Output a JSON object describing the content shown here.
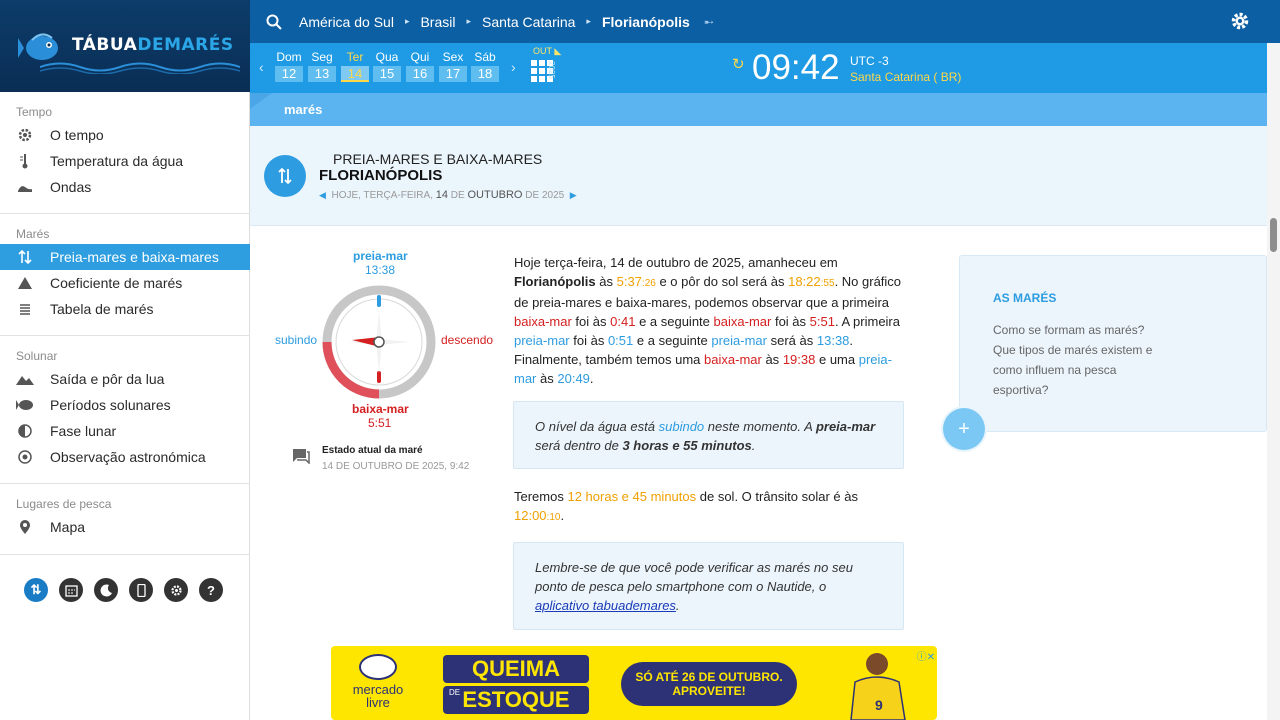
{
  "brand": {
    "logo_prefix": "TÁBUA",
    "logo_highlight": "DEMARÉS"
  },
  "breadcrumb": [
    {
      "label": "América do Sul"
    },
    {
      "label": "Brasil"
    },
    {
      "label": "Santa Catarina"
    },
    {
      "label": "Florianópolis"
    }
  ],
  "sidebar": {
    "sections": [
      {
        "heading": "Tempo",
        "items": [
          {
            "label": "O tempo",
            "icon": "gear-icon"
          },
          {
            "label": "Temperatura da água",
            "icon": "thermometer-icon"
          },
          {
            "label": "Ondas",
            "icon": "waves-icon"
          }
        ]
      },
      {
        "heading": "Marés",
        "items": [
          {
            "label": "Preia-mares e baixa-mares",
            "icon": "up-down-arrows-icon",
            "active": true
          },
          {
            "label": "Coeficiente de marés",
            "icon": "triangle-icon"
          },
          {
            "label": "Tabela de marés",
            "icon": "table-icon"
          }
        ]
      },
      {
        "heading": "Solunar",
        "items": [
          {
            "label": "Saída e pôr da lua",
            "icon": "mountains-icon"
          },
          {
            "label": "Períodos solunares",
            "icon": "fish-icon"
          },
          {
            "label": "Fase lunar",
            "icon": "half-moon-icon"
          },
          {
            "label": "Observação astronómica",
            "icon": "target-icon"
          }
        ]
      },
      {
        "heading": "Lugares de pesca",
        "items": [
          {
            "label": "Mapa",
            "icon": "map-pin-icon"
          }
        ]
      }
    ],
    "tools": [
      "tides-icon",
      "calendar-icon",
      "moon-icon",
      "phone-icon",
      "settings-icon",
      "help-icon"
    ]
  },
  "daybar": {
    "days": [
      {
        "name": "Dom",
        "date": "12"
      },
      {
        "name": "Seg",
        "date": "13"
      },
      {
        "name": "Ter",
        "date": "14",
        "active": true
      },
      {
        "name": "Qua",
        "date": "15"
      },
      {
        "name": "Qui",
        "date": "16"
      },
      {
        "name": "Sex",
        "date": "17"
      },
      {
        "name": "Sáb",
        "date": "18"
      }
    ],
    "month": "OUT",
    "year": "2025",
    "time": "09:42",
    "utc": "UTC -3",
    "region": "Santa Catarina ( BR)"
  },
  "section_strip": {
    "label": "marés"
  },
  "title_band": {
    "pretitle": "PREIA-MARES E BAIXA-MARES",
    "place": "FLORIANÓPOLIS",
    "date_prefix": "HOJE, TERÇA-FEIRA,",
    "date_day": "14",
    "date_de1": "DE",
    "date_month": "OUTUBRO",
    "date_de2": "DE",
    "date_year": "2025"
  },
  "dial": {
    "high_label": "preia-mar",
    "high_time": "13:38",
    "low_label": "baixa-mar",
    "low_time": "5:51",
    "left_label": "subindo",
    "right_label": "descendo",
    "colors": {
      "high": "#2d9ce0",
      "low": "#d42020"
    }
  },
  "estado": {
    "title": "Estado atual da maré",
    "timestamp": "14 DE OUTUBRO DE 2025, 9:42"
  },
  "description": {
    "p1": "Hoje terça-feira, 14 de outubro de 2025, amanheceu em",
    "place": "Florianópolis",
    "p2": "às",
    "sunrise": "5:37",
    "sunrise_sec": ":26",
    "p3": "e o pôr do sol será às",
    "sunset": "18:22",
    "sunset_sec": ":55",
    "p4": ". No gráfico de preia-mares e baixa-mares, podemos observar que a primeira",
    "low_word": "baixa-mar",
    "p5": "foi às",
    "low1": "0:41",
    "p6": "e a seguinte",
    "low2": "5:51",
    "p7": ". A primeira",
    "high_word": "preia-mar",
    "high1": "0:51",
    "high2": "13:38",
    "p8": "será às",
    "p9": ". Finalmente, também temos uma",
    "low3": "19:38",
    "p10": "e uma",
    "high3": "20:49",
    "p11": "."
  },
  "nivel": {
    "t1": "O nível da água está",
    "state": "subindo",
    "t2": "neste momento. A",
    "bold1": "preia-mar",
    "t3": "será dentro de",
    "bold2": "3 horas e 55 minutos",
    "t4": "."
  },
  "sun": {
    "t1": "Teremos",
    "duration": "12 horas e 45 minutos",
    "t2": "de sol. O trânsito solar é às",
    "transit": "12:00",
    "transit_sec": ":10",
    "t3": "."
  },
  "lembre": {
    "text": "Lembre-se de que você pode verificar as marés no seu ponto de pesca pelo smartphone com o Nautide, o",
    "link": "aplicativo tabuademares",
    "end": "."
  },
  "as_mares": {
    "heading": "AS MARÉS",
    "body": "Como se formam as marés? Que tipos de marés existem e como influem na pesca esportiva?"
  },
  "ad": {
    "brand": "mercado livre",
    "headline1": "QUEIMA",
    "de": "DE",
    "headline2": "ESTOQUE",
    "promo": "SÓ ATÉ 26 DE OUTUBRO. APROVEITE!"
  }
}
